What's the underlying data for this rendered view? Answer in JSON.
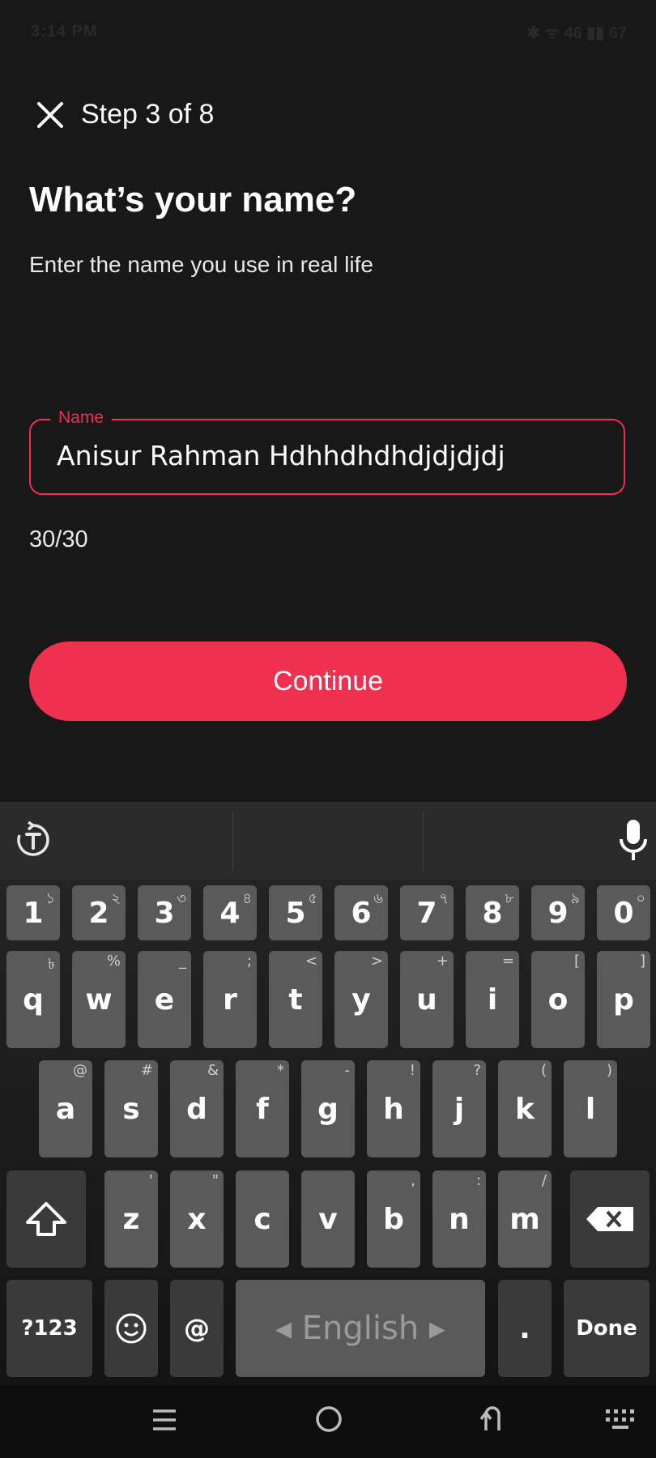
{
  "status_bar": {
    "time": "3:14 PM",
    "icons": "✱ ᯤ 46 ▮▮ 67"
  },
  "header": {
    "step_text": "Step 3 of 8"
  },
  "main": {
    "title": "What’s your name?",
    "subtitle": "Enter the name you use in real life",
    "name_label": "Name",
    "name_value": "Anisur Rahman Hdhhdhdhdjdjdjdj",
    "counter": "30/30",
    "continue_label": "Continue"
  },
  "keyboard": {
    "rows": [
      [
        {
          "k": "1",
          "s": "১"
        },
        {
          "k": "2",
          "s": "২"
        },
        {
          "k": "3",
          "s": "৩"
        },
        {
          "k": "4",
          "s": "৪"
        },
        {
          "k": "5",
          "s": "৫"
        },
        {
          "k": "6",
          "s": "৬"
        },
        {
          "k": "7",
          "s": "৭"
        },
        {
          "k": "8",
          "s": "৮"
        },
        {
          "k": "9",
          "s": "৯"
        },
        {
          "k": "0",
          "s": "০"
        }
      ],
      [
        {
          "k": "q",
          "s": "৳"
        },
        {
          "k": "w",
          "s": "%"
        },
        {
          "k": "e",
          "s": "_"
        },
        {
          "k": "r",
          "s": ";"
        },
        {
          "k": "t",
          "s": "<"
        },
        {
          "k": "y",
          "s": ">"
        },
        {
          "k": "u",
          "s": "+"
        },
        {
          "k": "i",
          "s": "="
        },
        {
          "k": "o",
          "s": "["
        },
        {
          "k": "p",
          "s": "]"
        }
      ],
      [
        {
          "k": "a",
          "s": "@"
        },
        {
          "k": "s",
          "s": "#"
        },
        {
          "k": "d",
          "s": "&"
        },
        {
          "k": "f",
          "s": "*"
        },
        {
          "k": "g",
          "s": "-"
        },
        {
          "k": "h",
          "s": "!"
        },
        {
          "k": "j",
          "s": "?"
        },
        {
          "k": "k",
          "s": "("
        },
        {
          "k": "l",
          "s": ")"
        }
      ],
      [
        {
          "k": "z",
          "s": "'"
        },
        {
          "k": "x",
          "s": "\""
        },
        {
          "k": "c",
          "s": ""
        },
        {
          "k": "v",
          "s": ""
        },
        {
          "k": "b",
          "s": ","
        },
        {
          "k": "n",
          "s": ":"
        },
        {
          "k": "m",
          "s": "/"
        }
      ]
    ],
    "symbols_label": "?123",
    "at_label": "@",
    "space_label": "◂ English ▸",
    "period_label": ".",
    "done_label": "Done"
  },
  "colors": {
    "accent": "#f0304f",
    "background": "#181818",
    "key": "#5a5a5a"
  }
}
